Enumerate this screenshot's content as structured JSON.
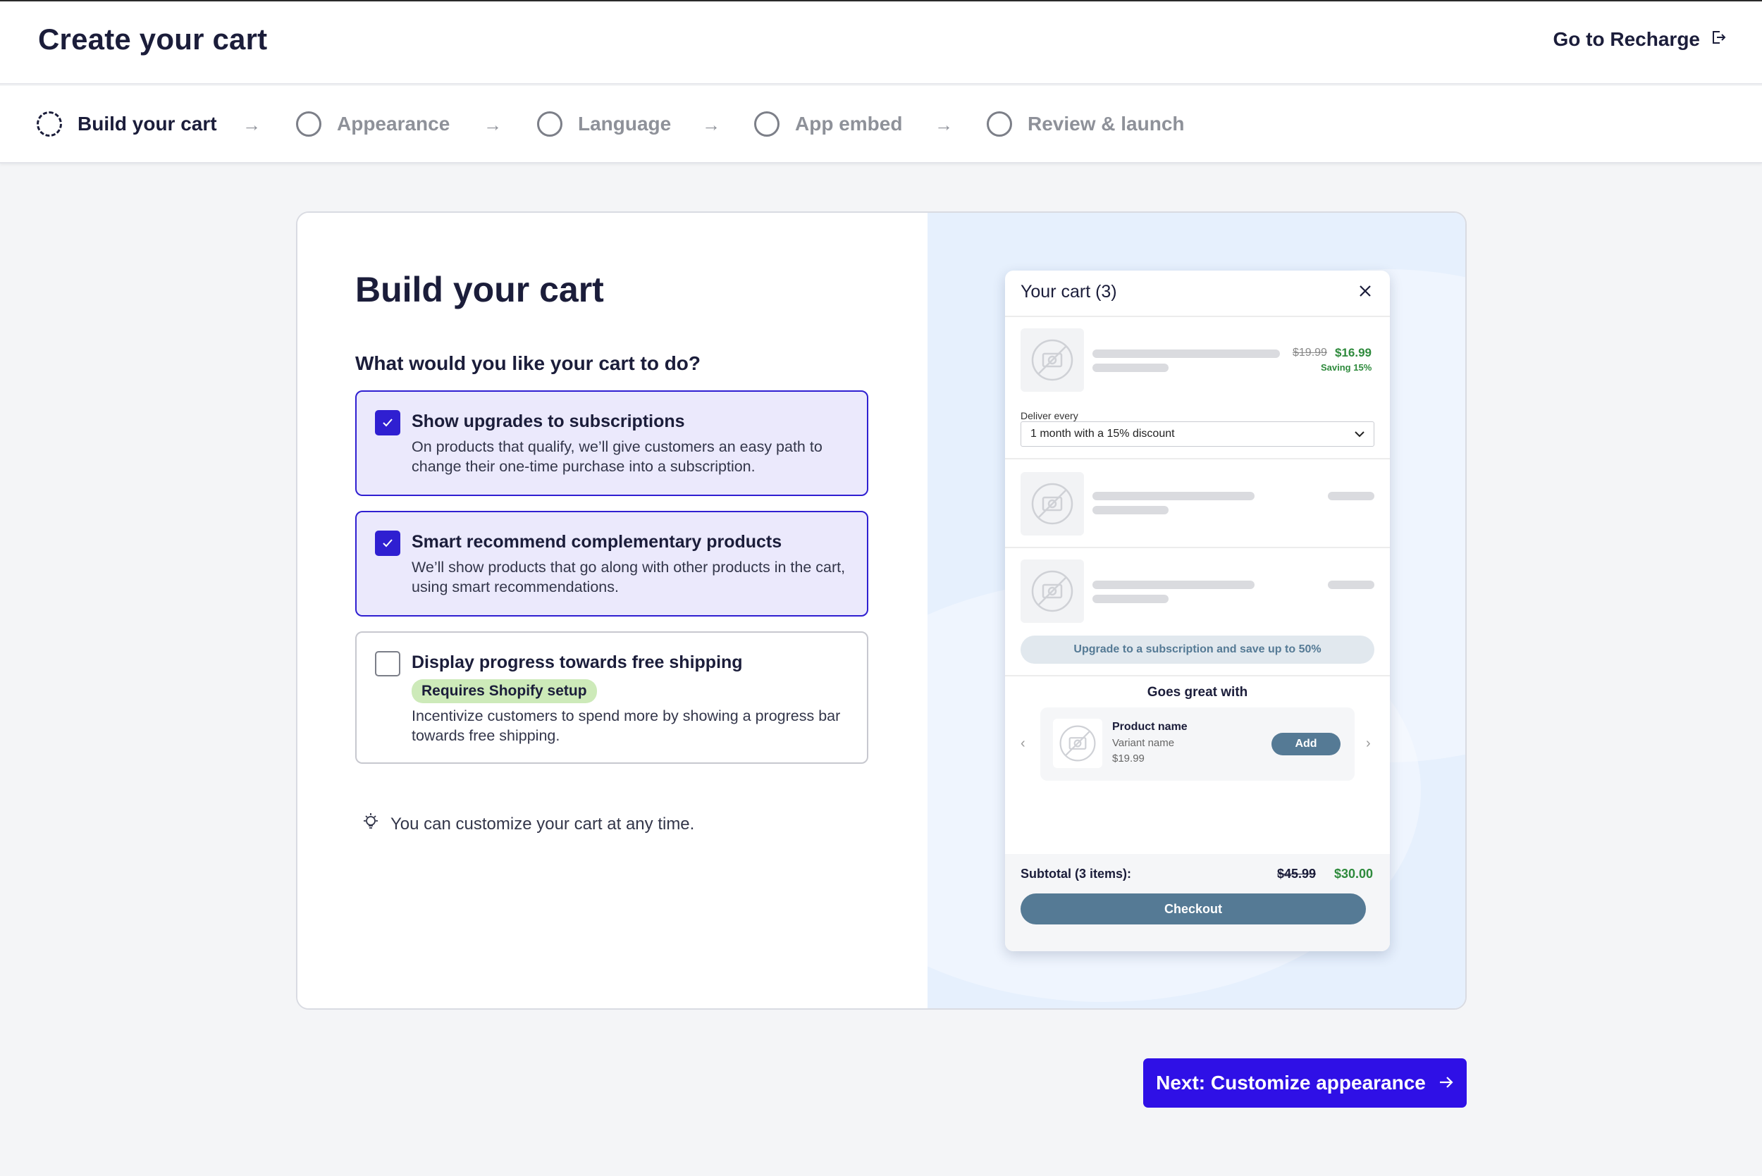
{
  "header": {
    "title": "Create your cart",
    "goto_label": "Go to Recharge"
  },
  "stepper": {
    "steps": [
      {
        "label": "Build your cart",
        "state": "active"
      },
      {
        "label": "Appearance",
        "state": "pending"
      },
      {
        "label": "Language",
        "state": "pending"
      },
      {
        "label": "App embed",
        "state": "pending"
      },
      {
        "label": "Review & launch",
        "state": "pending"
      }
    ]
  },
  "main": {
    "heading": "Build your cart",
    "question": "What would you like your cart to do?",
    "options": [
      {
        "title": "Show upgrades to subscriptions",
        "description": "On products that qualify, we’ll give customers an easy path to change their one-time purchase into a subscription.",
        "checked": true
      },
      {
        "title": "Smart recommend complementary products",
        "description": "We’ll show products that go along with other products in the cart, using smart recommendations.",
        "checked": true
      },
      {
        "title": "Display progress towards free shipping",
        "badge": "Requires Shopify setup",
        "description": "Incentivize customers to spend more by showing a progress bar towards free shipping.",
        "checked": false
      }
    ],
    "tip": "You can customize your cart at any time."
  },
  "cart_preview": {
    "title": "Your cart (3)",
    "item1": {
      "old_price": "$19.99",
      "new_price": "$16.99",
      "saving": "Saving 15%"
    },
    "deliver_label": "Deliver every",
    "deliver_value": "1 month with a 15% discount",
    "upgrade_label": "Upgrade to a subscription and save up to 50%",
    "goes_great_with": "Goes great with",
    "recommendation": {
      "product_name": "Product name",
      "variant_name": "Variant name",
      "price": "$19.99",
      "add_label": "Add"
    },
    "subtotal_label": "Subtotal (3 items):",
    "subtotal_old": "$45.99",
    "subtotal_new": "$30.00",
    "checkout_label": "Checkout"
  },
  "footer": {
    "next_label": "Next: Customize appearance"
  },
  "colors": {
    "primary": "#2f10e6",
    "checked_bg": "#ebe9fc",
    "preview_bg": "#e6f0fd",
    "cart_accent": "#557a95",
    "price_green": "#2e8a3c",
    "badge_green": "#cdeab9"
  }
}
